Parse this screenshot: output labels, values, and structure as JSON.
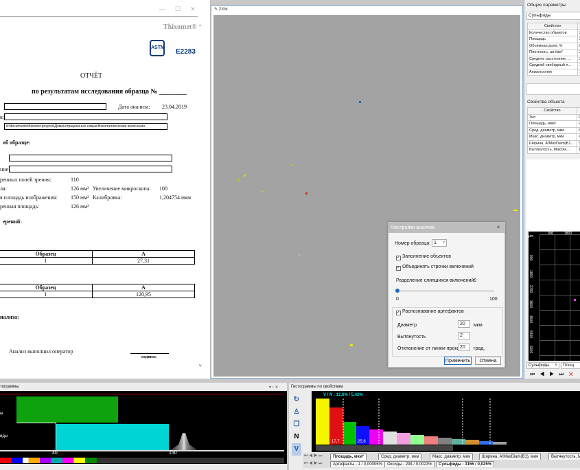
{
  "report": {
    "window_controls": [
      "—",
      "☐",
      "✕"
    ],
    "brand": "Thixomet®",
    "astm_logo_text": "ASTM",
    "standard": "E2283",
    "title": "ОТЧЁТ",
    "subtitle": "по результатам исследования образца № ________",
    "analysis_date_label": "Дата анализа:",
    "analysis_date": "23.04.2019",
    "path_label": "к:",
    "path": "d:\\documents\\thixomet.projects\\Демонстрационные новые\\Неметаллические включения",
    "sample_info": "об образце:",
    "note_label": "ние:",
    "fields_label": "ренных полей зрения:",
    "fields_value": "110",
    "area_label": "ля:",
    "area_value": "126 мм²",
    "mag_label": "Увеличение микроскопа:",
    "mag_value": "100",
    "img_area_label": "я площадь изображения:",
    "img_area_value": "150 мм²",
    "calib_label": "Калибровка:",
    "calib_value": "1,204754 мкм",
    "meas_area_label": "ренная площадь:",
    "meas_area_value": "126 мм²",
    "measurements_label": "ерений:",
    "table1": {
      "h1": "Образец",
      "h2": "A",
      "c1": "1",
      "c2": "27,31"
    },
    "table2": {
      "h1": "Образец",
      "h2": "A",
      "c1": "1",
      "c2": "120,95"
    },
    "analysis_label": "нализа:",
    "operator": "Анализ выполнил оператор",
    "signature": "подпись"
  },
  "viewer": {
    "tab": "2.thx"
  },
  "dialog": {
    "title": "Настройки анализа",
    "close": "✕",
    "sample_label": "Номер образца:",
    "sample_value": "1",
    "fill_objects": "Заполнение объектов",
    "merge_lines": "Объединять строчки включений",
    "split_label": "Разделение слипшихся включений:",
    "split_value": "0",
    "slider_min": "0",
    "slider_max": "100",
    "artifacts": "Распознавание артефактов",
    "diameter_label": "Диаметр",
    "diameter_value": "20",
    "diameter_unit": "мкм",
    "elong_label": "Вытянутость",
    "elong_value": "2",
    "deviation_label": "Отклонение от линии прокатки",
    "deviation_value": "20",
    "deviation_unit": "град.",
    "apply": "Применить",
    "cancel": "Отмена"
  },
  "rpanel": {
    "general_title": "Общие параметры",
    "select": "Сульфиды",
    "prop_header": "Свойство",
    "general_rows": [
      "Количество объектов",
      "Площадь",
      "Объёмная доля, %",
      "Плотность, шт./мм²",
      "Среднее расстояние, ...",
      "Средний свободный п...",
      "Анизотропия"
    ],
    "general_vals": [
      "3",
      "2",
      "0",
      "2",
      "2",
      "1",
      "1"
    ],
    "object_title": "Свойства объекта",
    "object_rows": [
      "Тип",
      "Площадь, мкм²",
      "Сред. диаметр, мкм",
      "Макс. диаметр, мкм",
      "Ширина, A/MaxDiam(B1...",
      "Вытянутость, MaxDia..."
    ],
    "object_vals": [
      "С",
      "2",
      "6",
      "7",
      "3",
      "1"
    ],
    "plot_unit": "μm",
    "plot_x": [
      "900",
      "1800"
    ],
    "plot_y": [
      "900",
      "1800",
      "2700",
      "3600",
      "4500",
      "5400",
      "6300"
    ],
    "bottom_select": "Сульфиды",
    "bottom_select2": "Площ",
    "nav": [
      "⏮",
      "◀",
      "▶",
      "⏭",
      "✕"
    ]
  },
  "bottom_left": {
    "title": "тограммы",
    "controls": "▾ ▫ ✕",
    "label1": "ы",
    "label2": "иды",
    "tick1": "40",
    "tick2": "150"
  },
  "bottom_right": {
    "title": "Гистограммы по свойствам",
    "tool_icons": [
      "rotate-icon",
      "person-icon",
      "copy-icon",
      "N",
      "V"
    ],
    "hist_label": "V / N : 12,6% / 5,42%",
    "val1": "17,7",
    "val2": "25,8",
    "tabs": [
      "Площадь, мкм²",
      "Сред. диаметр, мкм",
      "Макс. диаметр, мкм",
      "Ширина, A/MaxDiam(B1), мкм",
      "Вытянутость, MaxDiam/..."
    ],
    "tabs2": [
      "Артефакты - 1 / 0,00005%",
      "Оксиды - 294 / 0,0023%",
      "Сульфиды - 3155 / 0,025%"
    ]
  },
  "colors": {
    "accent": "#1e6bbf",
    "green_bar": "#0ea30e",
    "cyan_bar": "#00d4d4",
    "hist_yellow": "#f5f500",
    "hist_red": "#e01010"
  }
}
